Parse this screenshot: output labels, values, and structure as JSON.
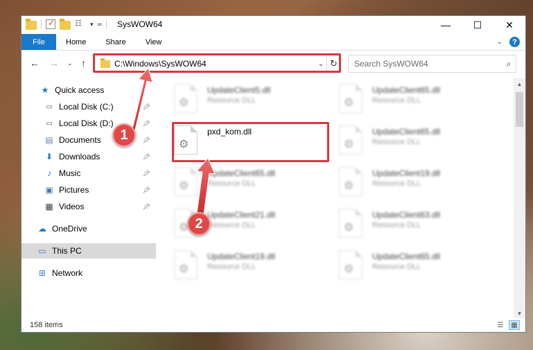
{
  "window": {
    "title": "SysWOW64",
    "controls": {
      "minimize": "—",
      "maximize": "☐",
      "close": "✕"
    }
  },
  "ribbon": {
    "file_tab": "File",
    "tabs": [
      "Home",
      "Share",
      "View"
    ]
  },
  "address": {
    "path": "C:\\Windows\\SysWOW64",
    "search_placeholder": "Search SysWOW64"
  },
  "sidebar": {
    "quick_access": "Quick access",
    "items": [
      {
        "label": "Local Disk (C:)",
        "icon": "drive-icon",
        "pinned": true
      },
      {
        "label": "Local Disk (D:)",
        "icon": "drive-icon",
        "pinned": true
      },
      {
        "label": "Documents",
        "icon": "documents-icon",
        "pinned": true
      },
      {
        "label": "Downloads",
        "icon": "downloads-icon",
        "pinned": true
      },
      {
        "label": "Music",
        "icon": "music-icon",
        "pinned": true
      },
      {
        "label": "Pictures",
        "icon": "pictures-icon",
        "pinned": true
      },
      {
        "label": "Videos",
        "icon": "videos-icon",
        "pinned": true
      }
    ],
    "onedrive": "OneDrive",
    "this_pc": "This PC",
    "network": "Network"
  },
  "files": {
    "highlighted": {
      "name": "pxd_kom.dll",
      "type": ""
    },
    "left_column": [
      {
        "name": "UpdateClient5.dll",
        "type": "Resource DLL"
      },
      {
        "name": "UpdateClient65.dll",
        "type": "Resource DLL"
      },
      {
        "name": "UpdateClient21.dll",
        "type": "Resource DLL"
      },
      {
        "name": "UpdateClient19.dll",
        "type": "Resource DLL"
      }
    ],
    "right_column": [
      {
        "name": "UpdateClient65.dll",
        "type": "Resource DLL"
      },
      {
        "name": "UpdateClient65.dll",
        "type": "Resource DLL"
      },
      {
        "name": "UpdateClient19.dll",
        "type": "Resource DLL"
      },
      {
        "name": "UpdateClient63.dll",
        "type": "Resource DLL"
      },
      {
        "name": "UpdateClient65.dll",
        "type": "Resource DLL"
      }
    ]
  },
  "status": {
    "item_count": "158 items"
  },
  "callouts": [
    "1",
    "2"
  ],
  "colors": {
    "accent": "#1979ca",
    "callout": "#e04848",
    "highlight_box": "#d9363e",
    "selected_nav": "#d9d9d9"
  }
}
